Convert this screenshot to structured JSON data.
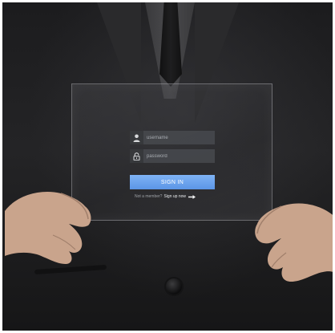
{
  "login": {
    "username_placeholder": "username",
    "password_placeholder": "password",
    "signin_label": "SIGN IN",
    "not_member_text": "Not a member?",
    "signup_label": "Sign up now"
  },
  "icons": {
    "username": "user-icon",
    "password": "lock-icon",
    "signup": "arrow-right-icon"
  },
  "colors": {
    "accent": "#6aa3ee",
    "field": "#46484c",
    "suit": "#1f1f21"
  }
}
